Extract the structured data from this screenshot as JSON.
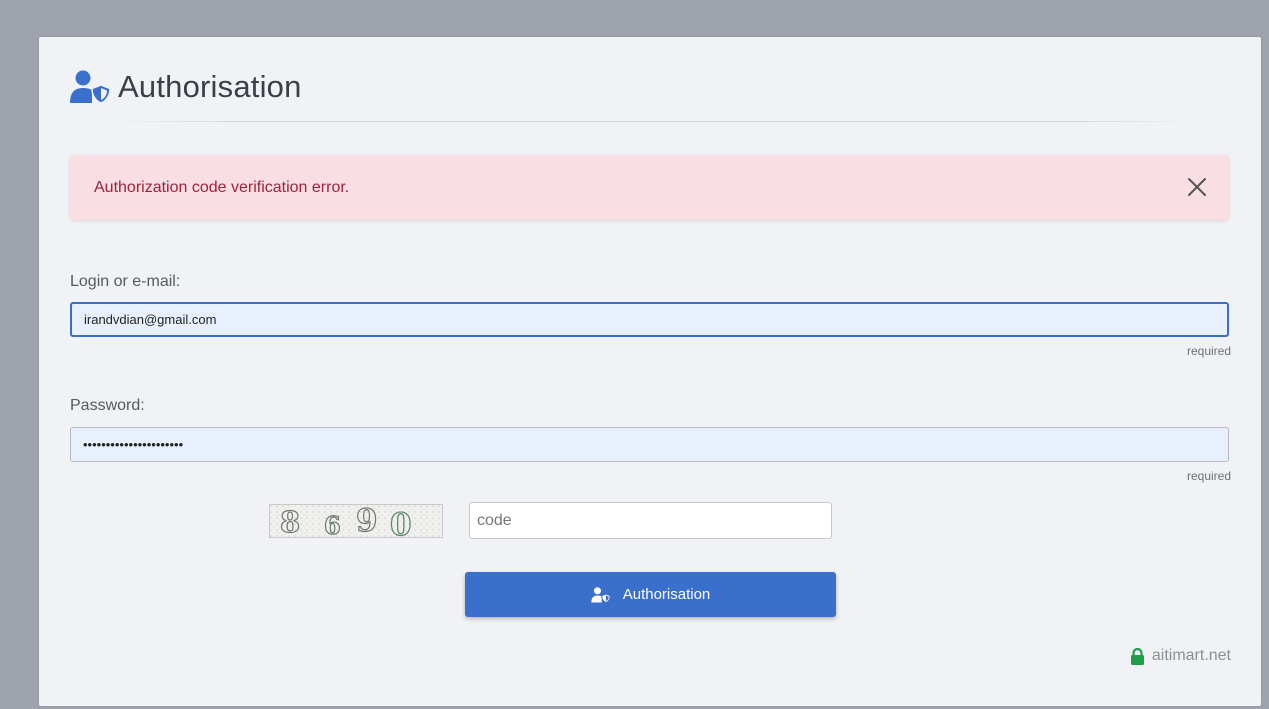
{
  "header": {
    "title": "Authorisation",
    "icon": "user-shield-icon"
  },
  "alert": {
    "message": "Authorization code verification error.",
    "close_icon": "close-icon"
  },
  "login": {
    "label": "Login or e-mail:",
    "value": "irandvdian@gmail.com",
    "hint": "required"
  },
  "password": {
    "label": "Password:",
    "value": "••••••••••••••••••••••",
    "hint": "required"
  },
  "captcha": {
    "digits": [
      "8",
      "6",
      "9",
      "0"
    ],
    "code_placeholder": "code"
  },
  "submit": {
    "label": "Authorisation",
    "icon": "user-shield-icon"
  },
  "footer": {
    "domain": "aitimart.net",
    "icon": "lock-icon",
    "lock_color": "#1e9e4a"
  },
  "colors": {
    "accent": "#3a6fcc",
    "error_text": "#a1223a",
    "error_bg": "#f9dfe3"
  }
}
